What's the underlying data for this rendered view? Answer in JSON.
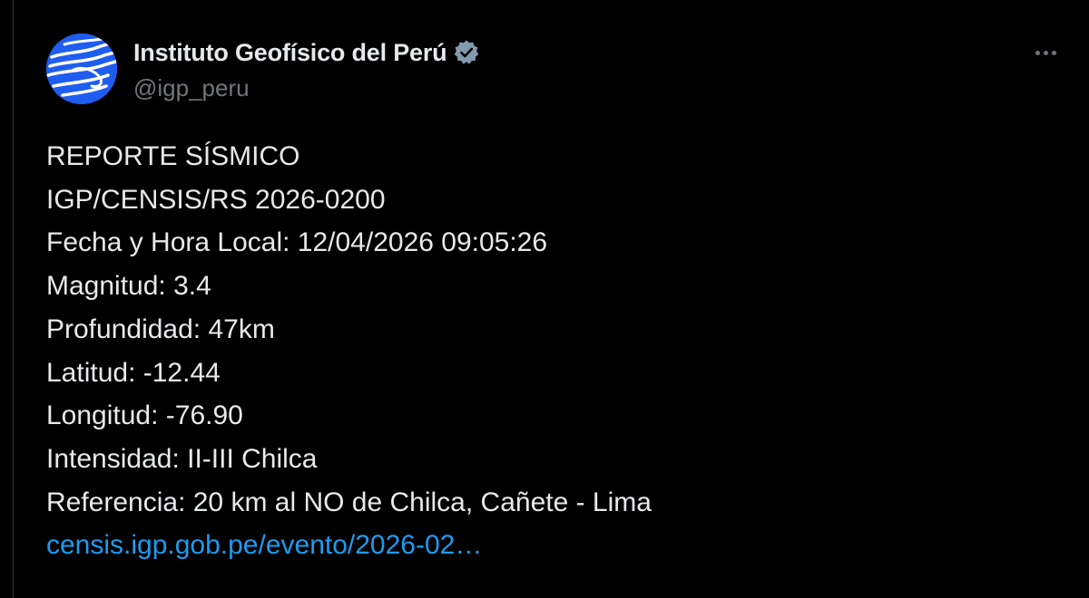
{
  "author": {
    "display_name": "Instituto Geofísico del Perú",
    "handle": "@igp_peru",
    "verified": true,
    "avatar_icon": "igp-logo-icon",
    "verified_icon": "verified-badge-icon"
  },
  "more_menu": {
    "icon": "more-options-icon"
  },
  "tweet": {
    "lines": [
      "REPORTE SÍSMICO",
      "IGP/CENSIS/RS 2026-0200",
      "Fecha y Hora Local: 12/04/2026 09:05:26",
      "Magnitud: 3.4",
      "Profundidad: 47km",
      "Latitud: -12.44",
      "Longitud: -76.90",
      "Intensidad: II-III Chilca",
      "Referencia: 20 km al NO de Chilca, Cañete - Lima"
    ],
    "link_text": "censis.igp.gob.pe/evento/2026-02…"
  },
  "colors": {
    "background": "#000000",
    "text": "#e7e9ea",
    "secondary_text": "#71767b",
    "link": "#1d9bf0",
    "avatar": "#1f5cf0"
  }
}
